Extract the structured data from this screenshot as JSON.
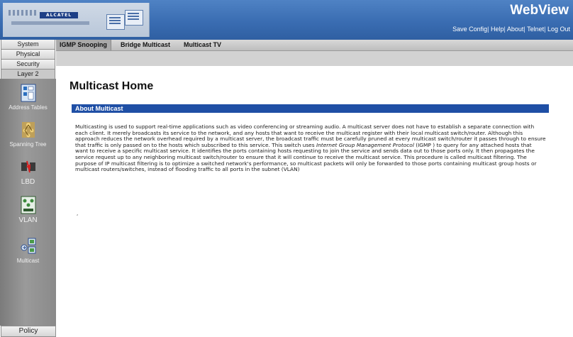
{
  "header": {
    "brand": "ALCATEL",
    "app_title": "WebView",
    "links": [
      "Save Config",
      "Help",
      "About",
      "Telnet",
      "Log Out"
    ]
  },
  "left_tabs": [
    "System",
    "Physical",
    "Security",
    "Layer 2"
  ],
  "sidebar": {
    "items": [
      {
        "label": "Address Tables",
        "icon": "address-tables-icon"
      },
      {
        "label": "Spanning Tree",
        "icon": "spanning-tree-icon"
      },
      {
        "label": "LBD",
        "icon": "lbd-icon"
      },
      {
        "label": "VLAN",
        "icon": "vlan-icon"
      },
      {
        "label": "Multicast",
        "icon": "multicast-icon"
      }
    ],
    "bottom_tab": "Policy"
  },
  "top_tabs": [
    "IGMP Snooping",
    "Bridge Multicast",
    "Multicast TV"
  ],
  "page": {
    "title": "Multicast Home",
    "section_title": "About Multicast",
    "body_part1": "Multicasting is used to support real-time applications such as video conferencing or streaming audio. A multicast server does not have to establish a separate connection with each client. It merely broadcasts its service to the network, and any hosts that want to receive the multicast register with their local multicast switch/router. Although this approach reduces the network overhead required by a multicast server, the broadcast traffic must be carefully pruned at every multicast switch/router it passes through to ensure that traffic is only passed on to the hosts which subscribed to this service. This switch uses ",
    "body_italic": "Internet Group Management Protocol",
    "body_part2": " (IGMP ) to query for any attached hosts that want to receive a specific multicast service. It identifies the ports containing hosts requesting to join the service and sends data out to those ports only. It then propagates the service request up to any neighboring multicast switch/router to ensure that it will continue to receive the multicast service. This procedure is called multicast filtering. The purpose of IP multicast filtering is to optimize a switched network's performance, so multicast packets will only be forwarded to those ports containing multicast group hosts or multicast routers/switches, instead of flooding traffic to all ports in the subnet (VLAN)",
    "trailing_mark": ","
  },
  "colors": {
    "header_blue": "#3a6db2",
    "section_bar": "#1f4fa5",
    "sidebar_gray": "#8a8a8a"
  }
}
